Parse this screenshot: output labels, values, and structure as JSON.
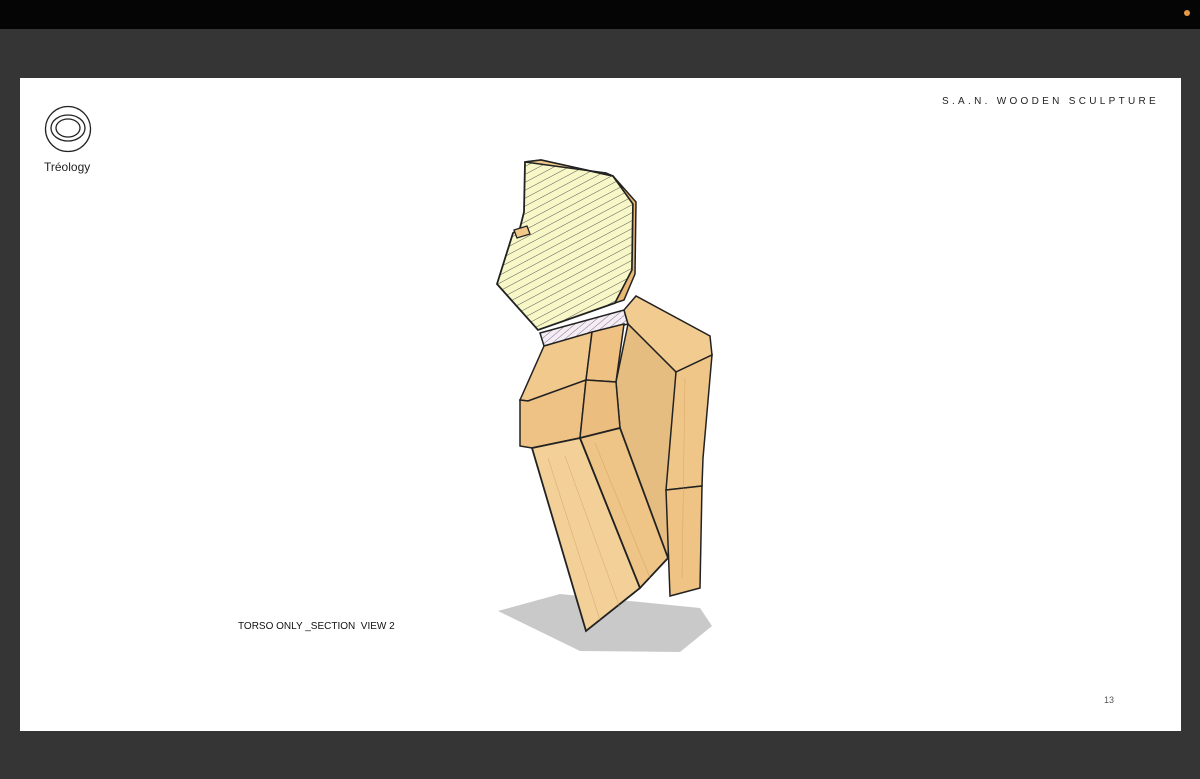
{
  "window": {
    "recording_indicator_color": "#e79a45",
    "background_color": "#353535"
  },
  "slide": {
    "brand_name": "Tréology",
    "logo_icon": "concentric-rings-logo",
    "project_title": "S.A.N. WOODEN SCULPTURE",
    "view_caption": "TORSO ONLY _SECTION  VIEW 2",
    "page_number": "13",
    "figure": {
      "subject": "wooden torso sculpture section render",
      "wood_color": "#f0c98a",
      "section_hatch_color": "#f7f7c8"
    }
  }
}
